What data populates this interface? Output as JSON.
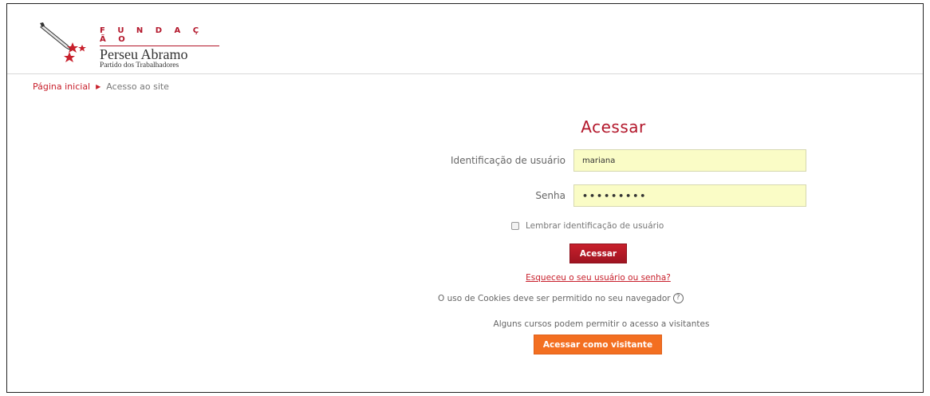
{
  "logo": {
    "line1": "F U N D A Ç Ã O",
    "line2": "Perseu Abramo",
    "line3": "Partido dos Trabalhadores"
  },
  "breadcrumb": {
    "home": "Página inicial",
    "separator_icon": "triangle-right-icon",
    "current": "Acesso ao site"
  },
  "login": {
    "title": "Acessar",
    "username_label": "Identificação de usuário",
    "username_value": "mariana",
    "password_label": "Senha",
    "password_value": "•••••••••",
    "remember_label": "Lembrar identificação de usuário",
    "remember_checked": false,
    "submit_label": "Acessar",
    "forgot_link": "Esqueceu o seu usuário ou senha?",
    "cookies_text": "O uso de Cookies deve ser permitido no seu navegador",
    "guests_text": "Alguns cursos podem permitir o acesso a visitantes",
    "guest_button": "Acessar como visitante"
  },
  "colors": {
    "brand_red": "#b3172b",
    "link_red": "#c8202c",
    "guest_orange": "#f36f21",
    "input_fill": "#fafcc6"
  }
}
